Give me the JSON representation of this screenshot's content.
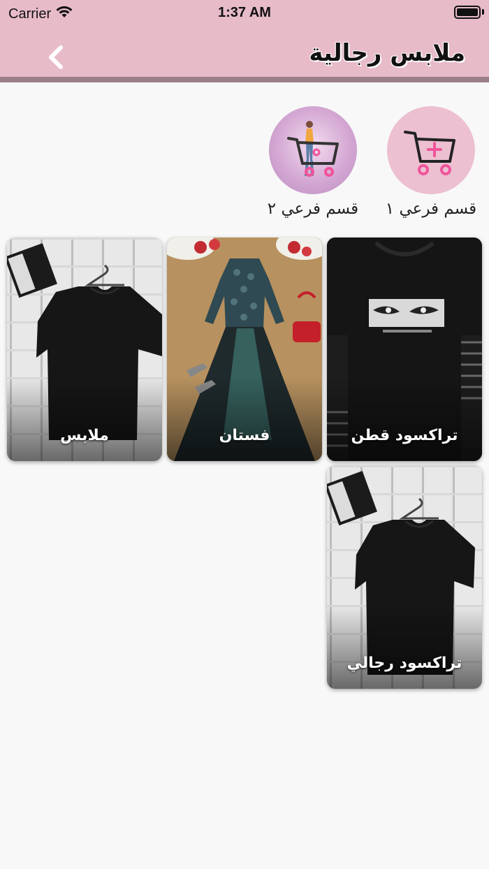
{
  "status_bar": {
    "carrier": "Carrier",
    "time": "1:37 AM"
  },
  "header": {
    "title": "ملابس رجالية",
    "back_icon": "chevron-left-icon"
  },
  "subcategories": [
    {
      "label": "قسم فرعي ١",
      "icon": "cart-plus-icon"
    },
    {
      "label": "قسم فرعي ٢",
      "icon": "cart-shopper-icon"
    }
  ],
  "products": [
    {
      "title": "تراكسود قطن",
      "image": "black-sweatshirt-anime-print"
    },
    {
      "title": "فستان",
      "image": "dress-with-heels-and-bag"
    },
    {
      "title": "ملابس",
      "image": "black-tshirt-on-wall"
    },
    {
      "title": "تراكسود رجالي",
      "image": "black-tshirt-on-wall"
    }
  ],
  "colors": {
    "header": "#e8bbc9",
    "header_shadow": "#9a7e88",
    "background": "#f8f8f8",
    "cart_pink": "#f0549b"
  }
}
